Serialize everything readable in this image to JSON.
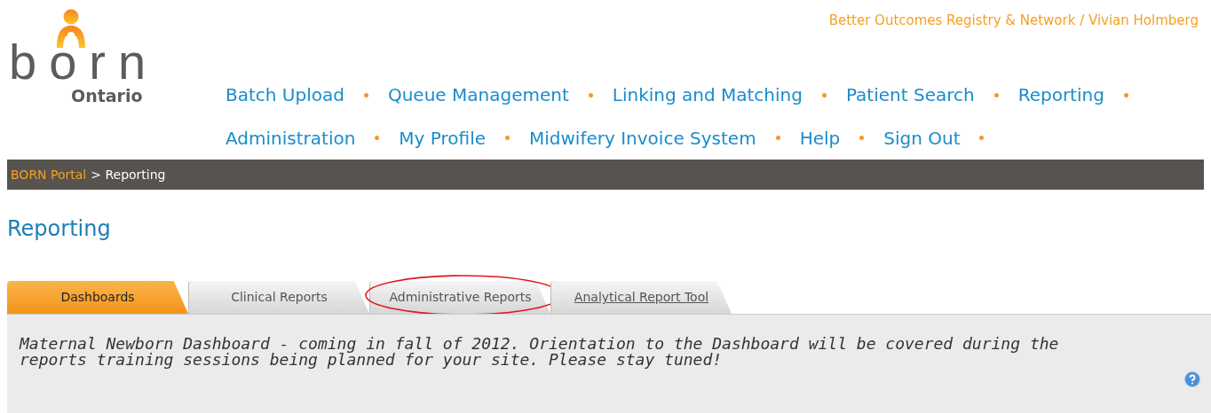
{
  "logo": {
    "word": "born",
    "region": "Ontario"
  },
  "account": "Better Outcomes Registry & Network / Vivian Holmberg",
  "nav": [
    {
      "label": "Batch Upload"
    },
    {
      "label": "Queue Management"
    },
    {
      "label": "Linking and Matching"
    },
    {
      "label": "Patient Search"
    },
    {
      "label": "Reporting"
    },
    {
      "label": "Administration"
    },
    {
      "label": "My Profile"
    },
    {
      "label": "Midwifery Invoice System"
    },
    {
      "label": "Help"
    },
    {
      "label": "Sign Out"
    }
  ],
  "breadcrumb": {
    "link": "BORN Portal",
    "current": "> Reporting"
  },
  "title": "Reporting",
  "tabs": [
    {
      "label": "Dashboards",
      "selected": true,
      "circled": false,
      "underlined": false
    },
    {
      "label": "Clinical Reports",
      "selected": false,
      "circled": false,
      "underlined": false
    },
    {
      "label": "Administrative Reports",
      "selected": false,
      "circled": true,
      "underlined": false
    },
    {
      "label": "Analytical Report Tool",
      "selected": false,
      "circled": false,
      "underlined": true
    }
  ],
  "message": "Maternal Newborn Dashboard - coming in fall of 2012. Orientation to the Dashboard will be covered during the reports training sessions being planned for your site. Please stay tuned!"
}
